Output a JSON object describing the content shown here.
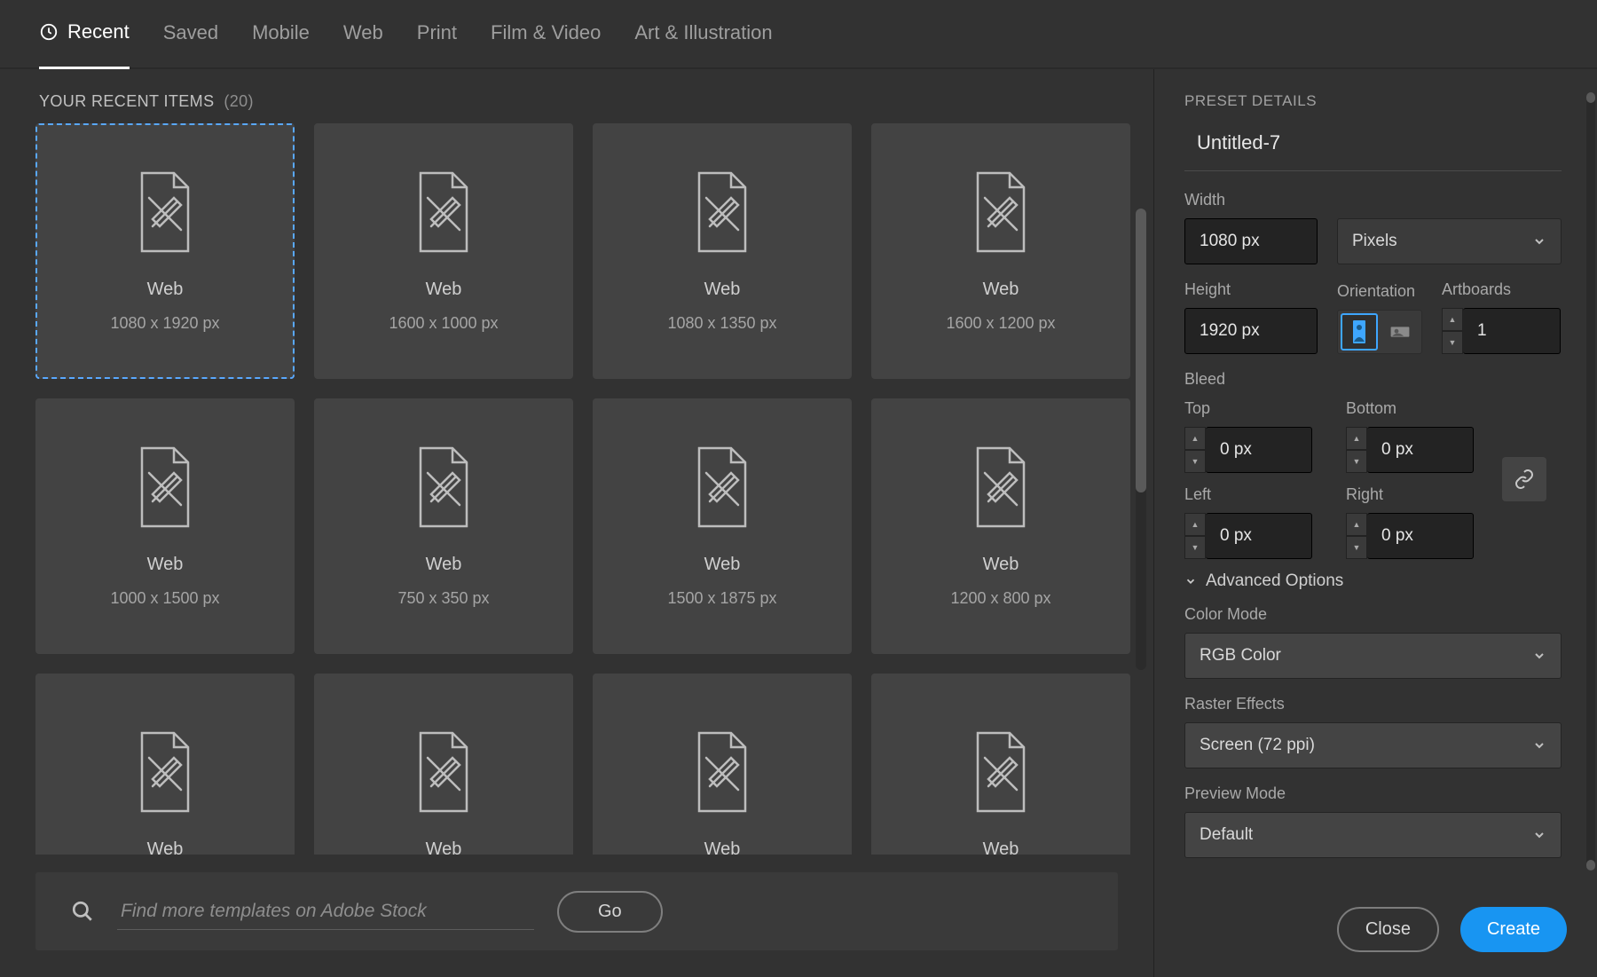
{
  "tabs": [
    "Recent",
    "Saved",
    "Mobile",
    "Web",
    "Print",
    "Film & Video",
    "Art & Illustration"
  ],
  "active_tab": 0,
  "recent": {
    "header": "YOUR RECENT ITEMS",
    "count": "(20)",
    "items": [
      {
        "title": "Web",
        "size": "1080 x 1920 px",
        "selected": true
      },
      {
        "title": "Web",
        "size": "1600 x 1000 px"
      },
      {
        "title": "Web",
        "size": "1080 x 1350 px"
      },
      {
        "title": "Web",
        "size": "1600 x 1200 px"
      },
      {
        "title": "Web",
        "size": "1000 x 1500 px"
      },
      {
        "title": "Web",
        "size": "750 x 350 px"
      },
      {
        "title": "Web",
        "size": "1500 x 1875 px"
      },
      {
        "title": "Web",
        "size": "1200 x 800 px"
      },
      {
        "title": "Web",
        "size": ""
      },
      {
        "title": "Web",
        "size": ""
      },
      {
        "title": "Web",
        "size": ""
      },
      {
        "title": "Web",
        "size": ""
      }
    ]
  },
  "search": {
    "placeholder": "Find more templates on Adobe Stock",
    "go": "Go"
  },
  "preset": {
    "section": "PRESET DETAILS",
    "name": "Untitled-7",
    "width_label": "Width",
    "width": "1080 px",
    "units": "Pixels",
    "height_label": "Height",
    "height": "1920 px",
    "orientation_label": "Orientation",
    "artboards_label": "Artboards",
    "artboards": "1",
    "bleed_label": "Bleed",
    "top_label": "Top",
    "top": "0 px",
    "bottom_label": "Bottom",
    "bottom": "0 px",
    "left_label": "Left",
    "left": "0 px",
    "right_label": "Right",
    "right": "0 px",
    "advanced": "Advanced Options",
    "color_mode_label": "Color Mode",
    "color_mode": "RGB Color",
    "raster_label": "Raster Effects",
    "raster": "Screen (72 ppi)",
    "preview_label": "Preview Mode",
    "preview": "Default"
  },
  "footer": {
    "close": "Close",
    "create": "Create"
  }
}
